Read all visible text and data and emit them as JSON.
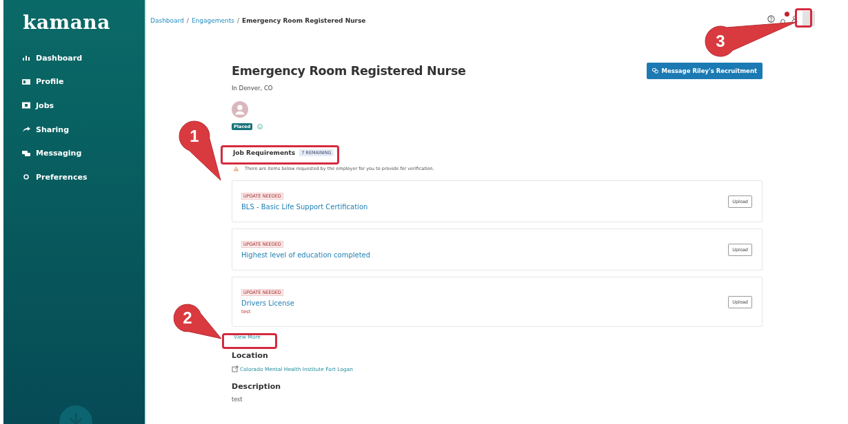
{
  "sidebar": {
    "logo": "kamana",
    "items": [
      {
        "label": "Dashboard",
        "selected": false
      },
      {
        "label": "Profile",
        "selected": false
      },
      {
        "label": "Jobs",
        "selected": false
      },
      {
        "label": "Sharing",
        "selected": false
      },
      {
        "label": "Messaging",
        "selected": false
      },
      {
        "label": "Preferences",
        "selected": false
      }
    ]
  },
  "breadcrumb": [
    {
      "label": "Dashboard",
      "kind": "link"
    },
    {
      "label": "/",
      "kind": "separator"
    },
    {
      "label": "Engagements",
      "kind": "link"
    },
    {
      "label": "/",
      "kind": "separator"
    },
    {
      "label": "Emergency Room Registered Nurse",
      "kind": "current"
    }
  ],
  "header": {
    "notifications": {
      "unread": true
    }
  },
  "job": {
    "title": "Emergency Room Registered Nurse",
    "location_line": "In Denver, CO",
    "status": "Placed",
    "message_button": "Message Riley's Recruitment"
  },
  "requirements": {
    "title": "Job Requirements",
    "badge": "7 REMAINING",
    "notice": "There are items below requested by the employer for you to provide for verification.",
    "items": [
      {
        "badge": "UPDATE NEEDED",
        "name": "BLS - Basic Life Support Certification",
        "button": "Upload"
      },
      {
        "badge": "UPDATE NEEDED",
        "name": "Highest level of education completed",
        "button": "Upload"
      },
      {
        "badge": "UPDATE NEEDED",
        "name": "Drivers License",
        "note": "test",
        "button": "Upload"
      }
    ],
    "view_more": "View More"
  },
  "location": {
    "title": "Location",
    "link": "Colorado Mental Health Institute Fort Logan"
  },
  "description": {
    "title": "Description",
    "text": "test"
  },
  "callouts": [
    {
      "number": "1"
    },
    {
      "number": "2"
    },
    {
      "number": "3"
    }
  ]
}
